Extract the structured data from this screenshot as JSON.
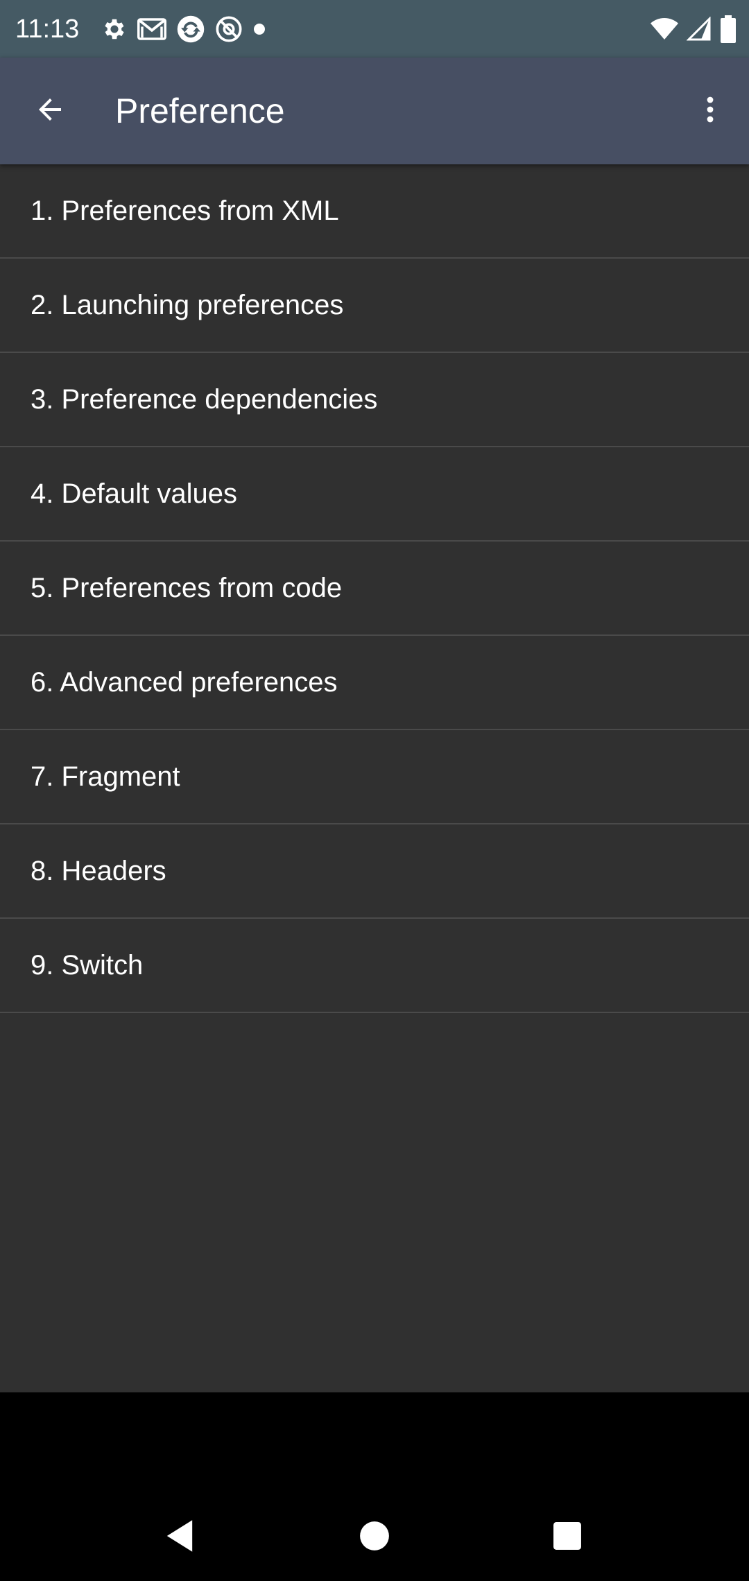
{
  "status_bar": {
    "time": "11:13",
    "left_icons": [
      "settings-icon",
      "gmail-icon",
      "sync-icon",
      "at-sign-icon",
      "dot-icon"
    ],
    "right_icons": [
      "wifi-icon",
      "cellular-signal-icon",
      "battery-icon"
    ]
  },
  "app_bar": {
    "title": "Preference",
    "back_icon": "arrow-back-icon",
    "overflow_icon": "more-vert-icon"
  },
  "list": {
    "items": [
      {
        "label": "1. Preferences from XML"
      },
      {
        "label": "2. Launching preferences"
      },
      {
        "label": "3. Preference dependencies"
      },
      {
        "label": "4. Default values"
      },
      {
        "label": "5. Preferences from code"
      },
      {
        "label": "6. Advanced preferences"
      },
      {
        "label": "7. Fragment"
      },
      {
        "label": "8. Headers"
      },
      {
        "label": "9. Switch"
      }
    ]
  },
  "nav_bar": {
    "icons": [
      "nav-back-icon",
      "nav-home-icon",
      "nav-recents-icon"
    ]
  },
  "colors": {
    "status_bar": "#455a64",
    "app_bar": "#474f63",
    "background": "#303030",
    "divider": "#4a4a4a",
    "nav_bar": "#000000",
    "text": "#ffffff"
  }
}
